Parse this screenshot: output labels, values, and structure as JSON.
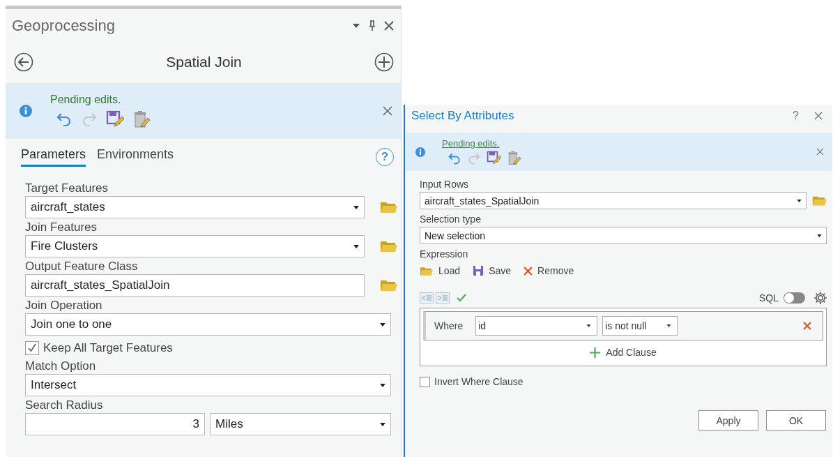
{
  "geoprocessing": {
    "title": "Geoprocessing",
    "tool_title": "Spatial Join",
    "help": "?",
    "banner": {
      "message": "Pending edits."
    },
    "tabs": [
      {
        "label": "Parameters",
        "selected": true
      },
      {
        "label": "Environments",
        "selected": false
      }
    ],
    "parameters": [
      {
        "kind": "dropdown",
        "label": "Target Features",
        "value": "aircraft_states",
        "browse": true
      },
      {
        "kind": "text",
        "label": "Join Features",
        "value": "Fire Clusters",
        "browse": true,
        "dropdown": true
      },
      {
        "kind": "text",
        "label": "Output Feature Class",
        "value": "aircraft_states_SpatialJoin",
        "browse": true,
        "dropdown": false
      },
      {
        "kind": "dropdown",
        "label": "Join Operation",
        "value": "Join one to one",
        "browse": false
      },
      {
        "kind": "checkbox",
        "label": "Keep All Target Features",
        "checked": true
      },
      {
        "kind": "dropdown",
        "label": "Match Option",
        "value": "Intersect",
        "browse": false
      },
      {
        "kind": "distance",
        "label": "Search Radius",
        "value": "3",
        "unit": "Miles"
      }
    ]
  },
  "select_by_attributes": {
    "title": "Select By Attributes",
    "help": "?",
    "banner": {
      "message": "Pending edits."
    },
    "input_rows": {
      "label": "Input Rows",
      "value": "aircraft_states_SpatialJoin"
    },
    "selection_type": {
      "label": "Selection type",
      "value": "New selection"
    },
    "expression": {
      "label": "Expression",
      "actions": [
        "Load",
        "Save",
        "Remove"
      ],
      "sql_label": "SQL",
      "sql_on": false,
      "clause": {
        "keyword": "Where",
        "field": "id",
        "operator": "is not null"
      },
      "add_clause": "Add Clause"
    },
    "invert": {
      "label": "Invert Where Clause",
      "checked": false
    },
    "buttons": [
      "Apply",
      "OK"
    ]
  }
}
